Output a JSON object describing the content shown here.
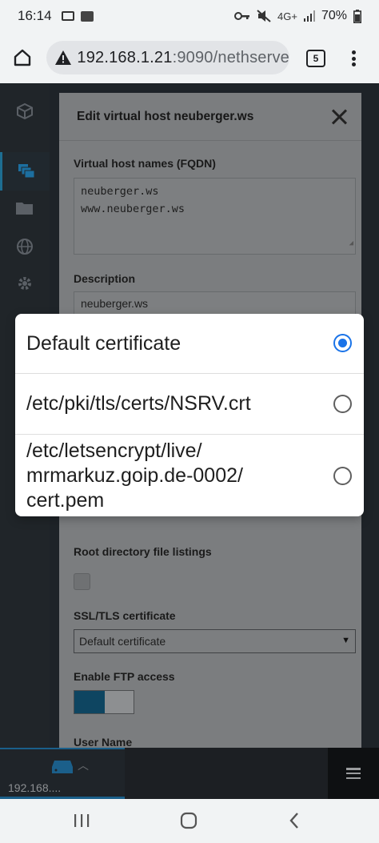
{
  "status_bar": {
    "time": "16:14",
    "battery": "70%",
    "network": "4G+",
    "icons": [
      "screen-record-icon",
      "gmail-icon",
      "vpn-key-icon",
      "mute-icon",
      "signal-icon",
      "battery-icon"
    ]
  },
  "browser": {
    "url_host": "192.168.1.21",
    "url_rest": ":9090/nethserve",
    "tab_count": "5",
    "icons": [
      "home-icon",
      "warning-icon",
      "tabs-icon",
      "more-vert-icon"
    ]
  },
  "side_nav": {
    "items": [
      "cube-icon",
      "layers-icon",
      "folder-icon",
      "globe-icon",
      "gear-icon"
    ],
    "active": "layers-icon"
  },
  "modal": {
    "title": "Edit virtual host neuberger.ws",
    "fqdn_label": "Virtual host names (FQDN)",
    "fqdn_lines": [
      "neuberger.ws",
      "www.neuberger.ws"
    ],
    "description_label": "Description",
    "description_value": "neuberger.ws",
    "root_listing_label": "Root directory file listings",
    "root_listing_checked": false,
    "ssl_label": "SSL/TLS certificate",
    "ssl_value": "Default certificate",
    "ftp_label": "Enable FTP access",
    "ftp_enabled": true,
    "username_label": "User Name"
  },
  "picker": {
    "options": [
      {
        "label": "Default certificate",
        "selected": true
      },
      {
        "label": "/etc/pki/tls/certs/NSRV.crt",
        "selected": false
      },
      {
        "label": "/etc/letsencrypt/live/\nmrmarkuz.goip.de-0002/\ncert.pem",
        "selected": false
      }
    ]
  },
  "dock": {
    "host": "192.168...."
  },
  "android_nav": [
    "recents-icon",
    "home-icon",
    "back-icon"
  ],
  "colors": {
    "accent": "#1a73e8",
    "toggle_on": "#0e4561",
    "nav_active": "#1d6e92"
  }
}
